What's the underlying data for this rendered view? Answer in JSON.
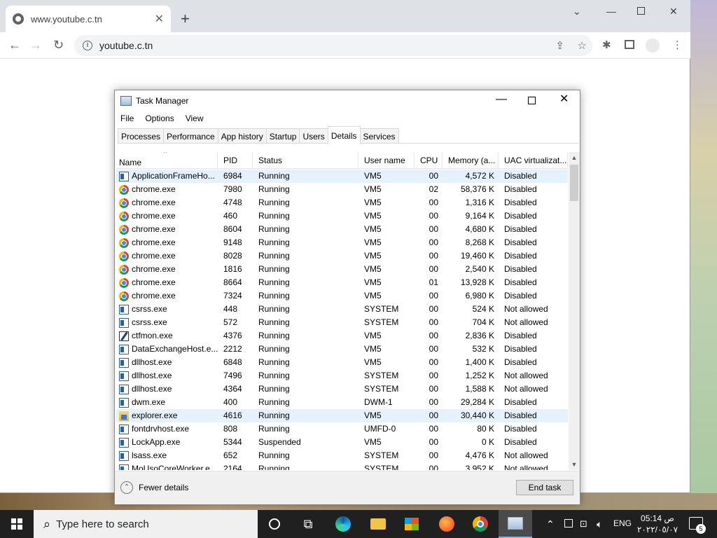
{
  "browser": {
    "tab_title": "www.youtube.c.tn",
    "url": "youtube.c.tn"
  },
  "task_manager": {
    "title": "Task Manager",
    "menu": [
      "File",
      "Options",
      "View"
    ],
    "tabs": [
      "Processes",
      "Performance",
      "App history",
      "Startup",
      "Users",
      "Details",
      "Services"
    ],
    "active_tab": "Details",
    "columns": [
      "Name",
      "PID",
      "Status",
      "User name",
      "CPU",
      "Memory (a...",
      "UAC virtualizat..."
    ],
    "rows": [
      {
        "icon": "generic",
        "name": "ApplicationFrameHo...",
        "pid": "6984",
        "status": "Running",
        "user": "VM5",
        "cpu": "00",
        "mem": "4,572 K",
        "uac": "Disabled",
        "selected": true
      },
      {
        "icon": "chrome",
        "name": "chrome.exe",
        "pid": "7980",
        "status": "Running",
        "user": "VM5",
        "cpu": "02",
        "mem": "58,376 K",
        "uac": "Disabled"
      },
      {
        "icon": "chrome",
        "name": "chrome.exe",
        "pid": "4748",
        "status": "Running",
        "user": "VM5",
        "cpu": "00",
        "mem": "1,316 K",
        "uac": "Disabled"
      },
      {
        "icon": "chrome",
        "name": "chrome.exe",
        "pid": "460",
        "status": "Running",
        "user": "VM5",
        "cpu": "00",
        "mem": "9,164 K",
        "uac": "Disabled"
      },
      {
        "icon": "chrome",
        "name": "chrome.exe",
        "pid": "8604",
        "status": "Running",
        "user": "VM5",
        "cpu": "00",
        "mem": "4,680 K",
        "uac": "Disabled"
      },
      {
        "icon": "chrome",
        "name": "chrome.exe",
        "pid": "9148",
        "status": "Running",
        "user": "VM5",
        "cpu": "00",
        "mem": "8,268 K",
        "uac": "Disabled"
      },
      {
        "icon": "chrome",
        "name": "chrome.exe",
        "pid": "8028",
        "status": "Running",
        "user": "VM5",
        "cpu": "00",
        "mem": "19,460 K",
        "uac": "Disabled"
      },
      {
        "icon": "chrome",
        "name": "chrome.exe",
        "pid": "1816",
        "status": "Running",
        "user": "VM5",
        "cpu": "00",
        "mem": "2,540 K",
        "uac": "Disabled"
      },
      {
        "icon": "chrome",
        "name": "chrome.exe",
        "pid": "8664",
        "status": "Running",
        "user": "VM5",
        "cpu": "01",
        "mem": "13,928 K",
        "uac": "Disabled"
      },
      {
        "icon": "chrome",
        "name": "chrome.exe",
        "pid": "7324",
        "status": "Running",
        "user": "VM5",
        "cpu": "00",
        "mem": "6,980 K",
        "uac": "Disabled"
      },
      {
        "icon": "generic",
        "name": "csrss.exe",
        "pid": "448",
        "status": "Running",
        "user": "SYSTEM",
        "cpu": "00",
        "mem": "524 K",
        "uac": "Not allowed"
      },
      {
        "icon": "generic",
        "name": "csrss.exe",
        "pid": "572",
        "status": "Running",
        "user": "SYSTEM",
        "cpu": "00",
        "mem": "704 K",
        "uac": "Not allowed"
      },
      {
        "icon": "pen",
        "name": "ctfmon.exe",
        "pid": "4376",
        "status": "Running",
        "user": "VM5",
        "cpu": "00",
        "mem": "2,836 K",
        "uac": "Disabled"
      },
      {
        "icon": "generic",
        "name": "DataExchangeHost.e...",
        "pid": "2212",
        "status": "Running",
        "user": "VM5",
        "cpu": "00",
        "mem": "532 K",
        "uac": "Disabled"
      },
      {
        "icon": "generic",
        "name": "dllhost.exe",
        "pid": "6848",
        "status": "Running",
        "user": "VM5",
        "cpu": "00",
        "mem": "1,400 K",
        "uac": "Disabled"
      },
      {
        "icon": "generic",
        "name": "dllhost.exe",
        "pid": "7496",
        "status": "Running",
        "user": "SYSTEM",
        "cpu": "00",
        "mem": "1,252 K",
        "uac": "Not allowed"
      },
      {
        "icon": "generic",
        "name": "dllhost.exe",
        "pid": "4364",
        "status": "Running",
        "user": "SYSTEM",
        "cpu": "00",
        "mem": "1,588 K",
        "uac": "Not allowed"
      },
      {
        "icon": "generic",
        "name": "dwm.exe",
        "pid": "400",
        "status": "Running",
        "user": "DWM-1",
        "cpu": "00",
        "mem": "29,284 K",
        "uac": "Disabled"
      },
      {
        "icon": "folder",
        "name": "explorer.exe",
        "pid": "4616",
        "status": "Running",
        "user": "VM5",
        "cpu": "00",
        "mem": "30,440 K",
        "uac": "Disabled",
        "selected": true
      },
      {
        "icon": "generic",
        "name": "fontdrvhost.exe",
        "pid": "808",
        "status": "Running",
        "user": "UMFD-0",
        "cpu": "00",
        "mem": "80 K",
        "uac": "Disabled"
      },
      {
        "icon": "generic",
        "name": "LockApp.exe",
        "pid": "5344",
        "status": "Suspended",
        "user": "VM5",
        "cpu": "00",
        "mem": "0 K",
        "uac": "Disabled"
      },
      {
        "icon": "generic",
        "name": "lsass.exe",
        "pid": "652",
        "status": "Running",
        "user": "SYSTEM",
        "cpu": "00",
        "mem": "4,476 K",
        "uac": "Not allowed"
      },
      {
        "icon": "generic",
        "name": "MoUsoCoreWorker.e...",
        "pid": "2164",
        "status": "Running",
        "user": "SYSTEM",
        "cpu": "00",
        "mem": "3,952 K",
        "uac": "Not allowed"
      }
    ],
    "fewer_details": "Fewer details",
    "end_task": "End task"
  },
  "taskbar": {
    "search_placeholder": "Type here to search",
    "language": "ENG",
    "time": "05:14 ص",
    "date": "٢٠٢٢/٠٥/٠٧",
    "notification_count": "5"
  },
  "colors": {
    "selected_row": "#e5f1fb",
    "taskbar": "#202020"
  }
}
